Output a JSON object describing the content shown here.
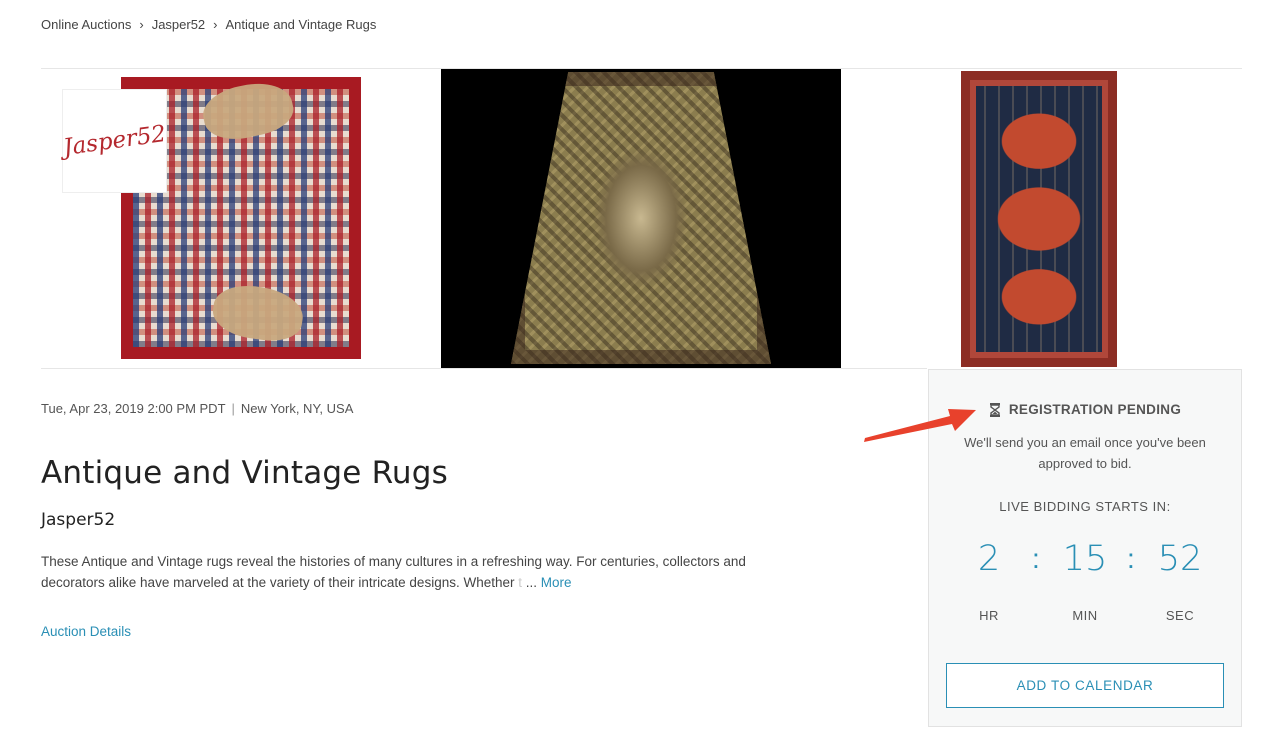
{
  "breadcrumb": {
    "items": [
      "Online Auctions",
      "Jasper52",
      "Antique and Vintage Rugs"
    ],
    "separator": "›"
  },
  "logo": {
    "text": "Jasper52"
  },
  "auction": {
    "date": "Tue, Apr 23, 2019 2:00 PM PDT",
    "separator": "|",
    "location": "New York, NY, USA",
    "title": "Antique and Vintage Rugs",
    "seller": "Jasper52",
    "description_main": "These Antique and Vintage rugs reveal the histories of many cultures in a refreshing way. For centuries, collectors and decorators alike have marveled at the variety of their intricate designs. Whether ",
    "description_faded": "t",
    "ellipsis": " ... ",
    "more_link": "More",
    "details_link": "Auction Details"
  },
  "sidebar": {
    "status_icon": "hourglass-icon",
    "status": "REGISTRATION PENDING",
    "note": "We'll send you an email once you've been approved to bid.",
    "starts_label": "LIVE BIDDING STARTS IN:",
    "countdown": {
      "hours": "2",
      "minutes": "15",
      "seconds": "52",
      "colon": ":"
    },
    "units": {
      "hours": "HR",
      "minutes": "MIN",
      "seconds": "SEC"
    },
    "calendar_button": "ADD TO CALENDAR"
  },
  "colors": {
    "accent": "#2a8fb5",
    "annotation_arrow": "#e8412c",
    "panel_bg": "#f7f8f8"
  }
}
